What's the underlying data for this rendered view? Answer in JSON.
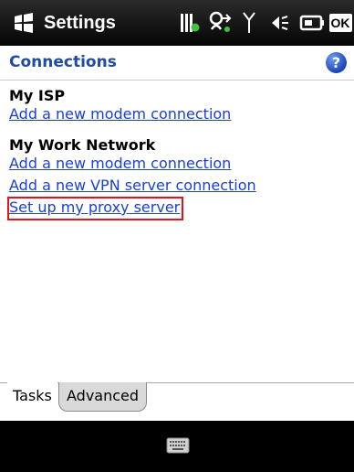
{
  "titlebar": {
    "title": "Settings",
    "start_icon": "windows-flag-icon",
    "tray_icons": [
      "battery-charging-icon",
      "network-sync-icon",
      "signal-antenna-icon",
      "speaker-icon",
      "battery-icon",
      "ok-button"
    ],
    "ok_label": "OK"
  },
  "header": {
    "title": "Connections",
    "help_label": "?"
  },
  "groups": [
    {
      "heading": "My ISP",
      "links": [
        "Add a new modem connection"
      ]
    },
    {
      "heading": "My Work Network",
      "links": [
        "Add a new modem connection",
        "Add a new VPN server connection",
        "Set up my proxy server"
      ]
    }
  ],
  "tabs": [
    {
      "label": "Tasks",
      "active": true
    },
    {
      "label": "Advanced",
      "active": false
    }
  ],
  "bottombar": {
    "icon": "keyboard-icon"
  },
  "colors": {
    "link": "#1a3fd8",
    "heading": "#1f4aa8",
    "highlight": "#e0141e",
    "titlebar": "#050505"
  }
}
